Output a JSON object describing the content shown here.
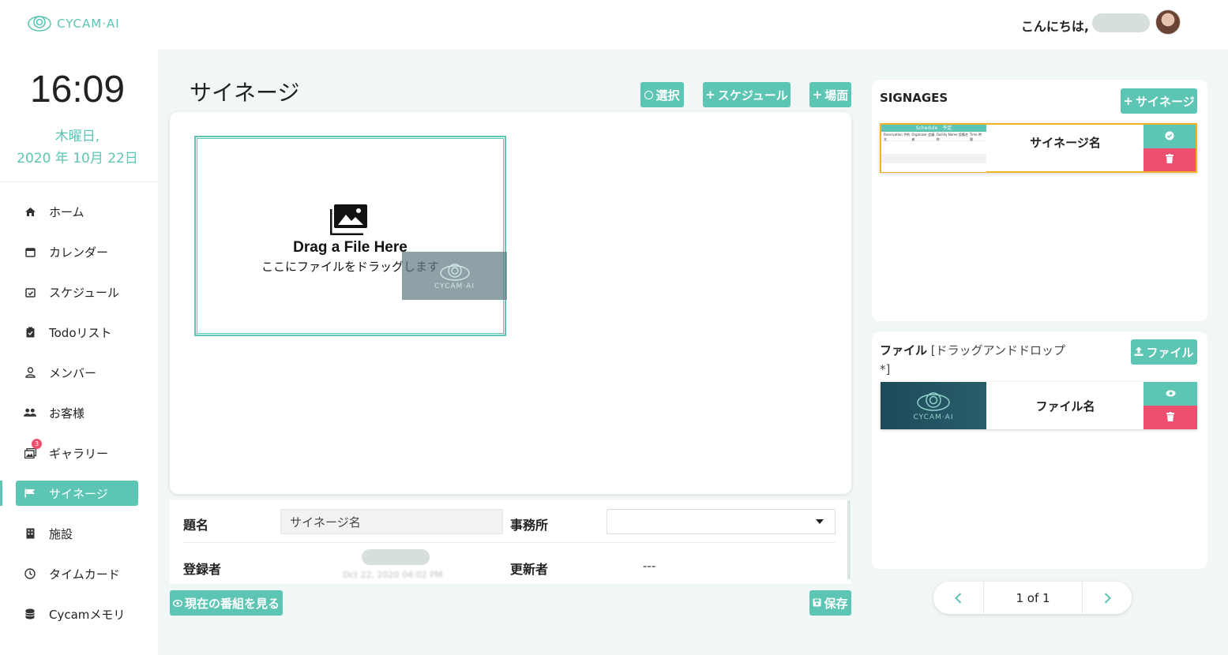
{
  "header": {
    "logo_text": "CYCAM·AI",
    "greeting": "こんにちは,"
  },
  "sidebar": {
    "time": "16:09",
    "date_weekday": "木曜日,",
    "date_full": "2020 年 10月 22日",
    "items": [
      {
        "label": "ホーム",
        "icon": "home-icon"
      },
      {
        "label": "カレンダー",
        "icon": "calendar-icon"
      },
      {
        "label": "スケジュール",
        "icon": "calendar-check-icon"
      },
      {
        "label": "Todoリスト",
        "icon": "clipboard-icon"
      },
      {
        "label": "メンバー",
        "icon": "user-icon"
      },
      {
        "label": "お客様",
        "icon": "users-icon"
      },
      {
        "label": "ギャラリー",
        "icon": "gallery-icon",
        "badge": "3"
      },
      {
        "label": "サイネージ",
        "icon": "flag-icon",
        "active": true
      },
      {
        "label": "施設",
        "icon": "building-icon"
      },
      {
        "label": "タイムカード",
        "icon": "clock-icon"
      },
      {
        "label": "Cycamメモリ",
        "icon": "database-icon"
      }
    ]
  },
  "main": {
    "title": "サイネージ",
    "btn_select": "選択",
    "btn_schedule": "スケジュール",
    "btn_scene": "場面",
    "drop_title": "Drag a File Here",
    "drop_subtitle": "ここにファイルをドラッグします",
    "thumb_logo_text": "CYCAM·AI",
    "form": {
      "title_label": "題名",
      "title_value": "サイネージ名",
      "office_label": "事務所",
      "office_value": "",
      "registrant_label": "登録者",
      "registered_date": "Oct 22, 2020 04:02 PM",
      "updater_label": "更新者",
      "updater_value": "---"
    },
    "btn_view_current": "現在の番組を見る",
    "btn_save": "保存"
  },
  "signages": {
    "title": "SIGNAGES",
    "add_button": "サイネージ",
    "item_name": "サイネージ名",
    "thumb_header": "Schedule　予定",
    "thumb_cols": [
      "Reservation 予約名",
      "Organizer 会議者",
      "Facility Name 設備名称",
      "Time 時間"
    ]
  },
  "files": {
    "title": "ファイル",
    "subtitle": "[ドラッグアンドドロップ *]",
    "upload_button": "ファイル",
    "item_name": "ファイル名",
    "thumb_logo_text": "CYCAM·AI"
  },
  "pager": {
    "text": "1 of 1"
  },
  "colors": {
    "accent": "#5cc5b3",
    "danger": "#ef4f6f",
    "highlight_border": "#f0b429"
  }
}
